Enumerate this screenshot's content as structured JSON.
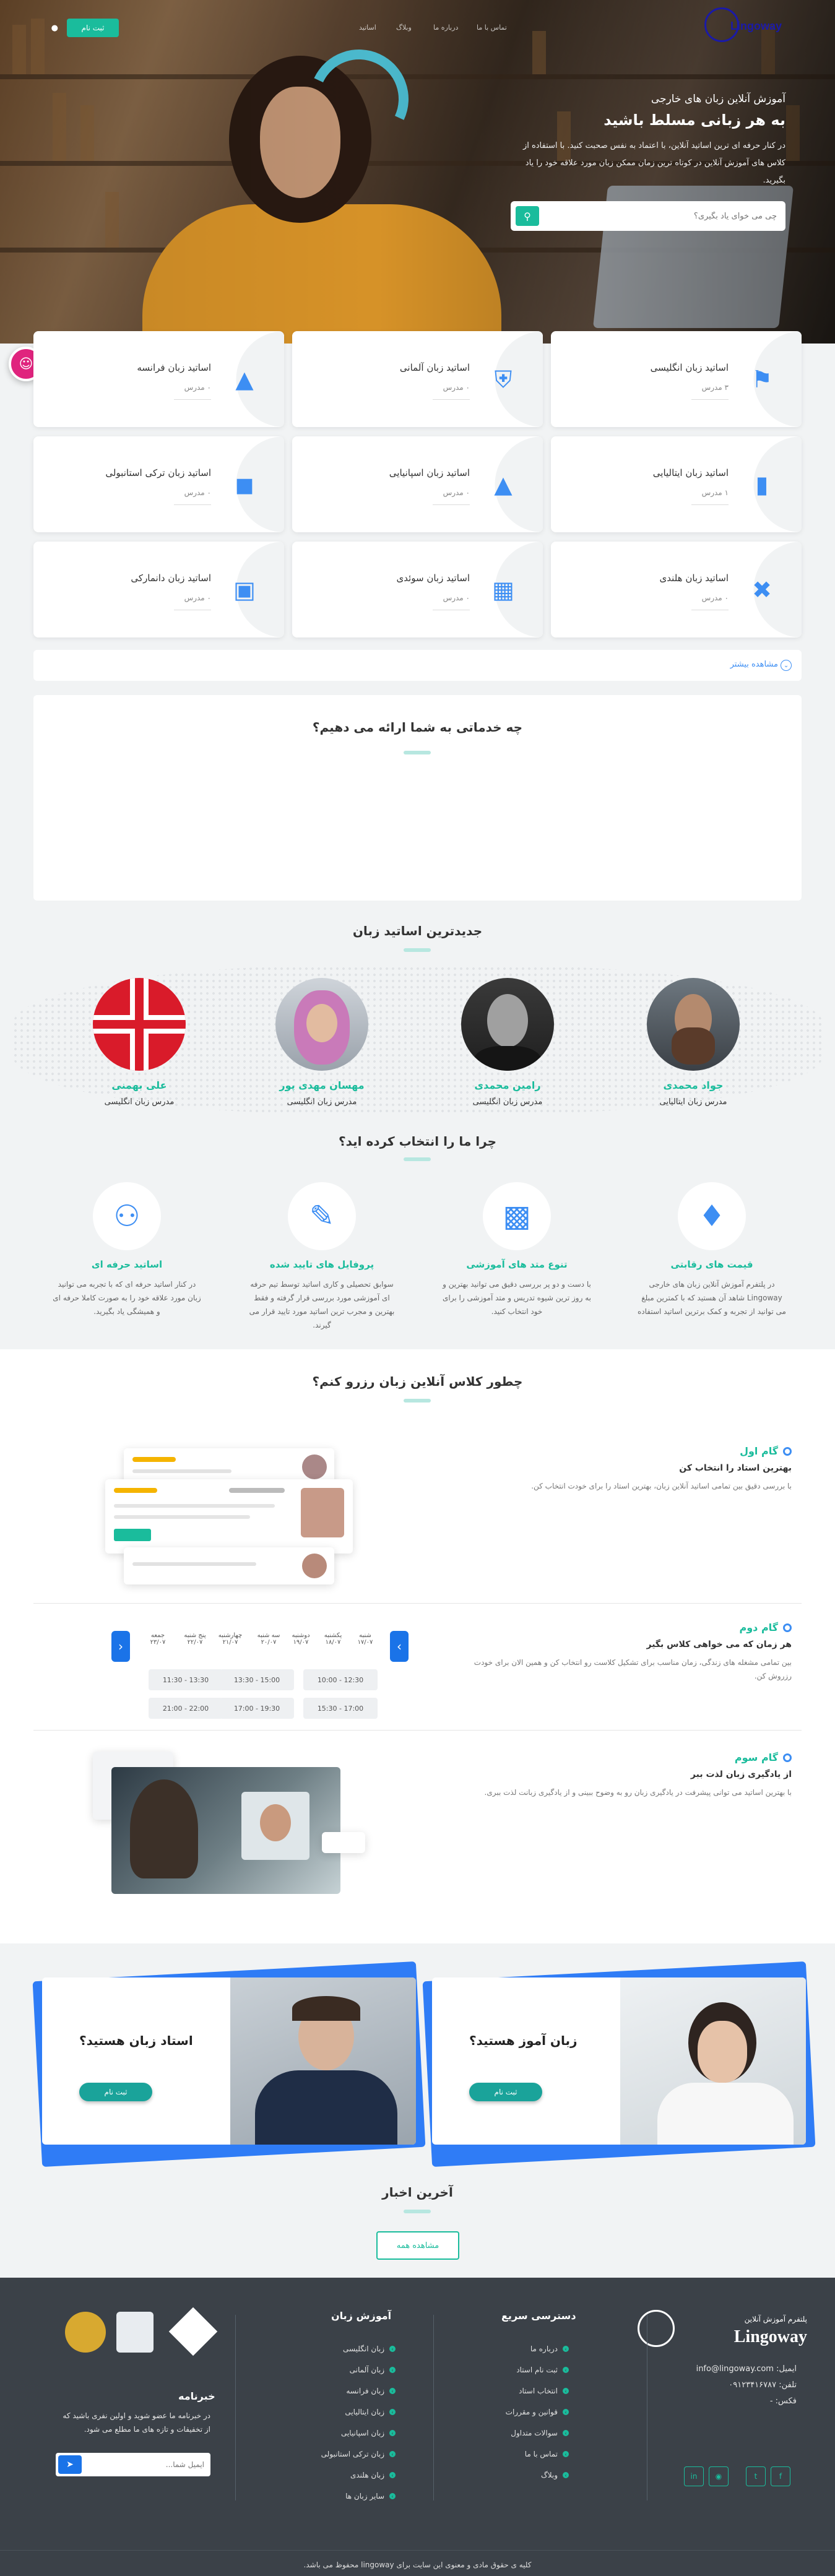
{
  "header": {
    "brand": "Lingoway",
    "register_label": "ثبت نام",
    "nav": [
      "اساتید",
      "وبلاگ",
      "درباره ما",
      "تماس با ما"
    ]
  },
  "hero": {
    "kicker": "آموزش آنلاین زبان های خارجی",
    "headline": "به هر زبانی مسلط باشید",
    "description": "در کنار حرفه ای ترین اساتید آنلاین، با اعتماد به نفس صحبت کنید. با استفاده از کلاس های آموزش آنلاین در کوتاه ترین زمان ممکن زبان مورد علاقه خود را یاد بگیرید.",
    "search_placeholder": "چی می خوای یاد بگیری؟"
  },
  "teacher_cards": [
    {
      "title": "اساتید زبان انگلیسی",
      "count": "۳ مدرس",
      "icon": "big-ben-icon"
    },
    {
      "title": "اساتید زبان آلمانی",
      "count": "۰ مدرس",
      "icon": "brandenburg-gate-icon"
    },
    {
      "title": "اساتید زبان فرانسه",
      "count": "۰ مدرس",
      "icon": "eiffel-tower-icon"
    },
    {
      "title": "اساتید زبان ایتالیایی",
      "count": "۱ مدرس",
      "icon": "pisa-tower-icon"
    },
    {
      "title": "اساتید زبان اسپانیایی",
      "count": "۰ مدرس",
      "icon": "sagrada-familia-icon"
    },
    {
      "title": "اساتید زبان ترکی استانبولی",
      "count": "۰ مدرس",
      "icon": "mosque-icon"
    },
    {
      "title": "اساتید زبان هلندی",
      "count": "۰ مدرس",
      "icon": "windmill-icon"
    },
    {
      "title": "اساتید زبان سوئدی",
      "count": "۰ مدرس",
      "icon": "swedish-building-icon"
    },
    {
      "title": "اساتید زبان دانمارکی",
      "count": "۰ مدرس",
      "icon": "danish-palace-icon"
    }
  ],
  "more_label": "مشاهده بیشتر",
  "services_title": "چه خدماتی به شما ارائه می دهیم؟",
  "new_teachers": {
    "title": "جدیدترین اساتید زبان",
    "items": [
      {
        "name": "جواد محمدی",
        "role": "مدرس زبان ایتالیایی"
      },
      {
        "name": "رامین محمدی",
        "role": "مدرس زبان انگلیسی"
      },
      {
        "name": "مهسان مهدی پور",
        "role": "مدرس زبان انگلیسی"
      },
      {
        "name": "علی بهمنی",
        "role": "مدرس زبان انگلیسی"
      }
    ]
  },
  "why_us": {
    "title": "چرا ما را انتخاب کرده اید؟",
    "items": [
      {
        "title": "قیمت های رقابتی",
        "desc": "در پلتفرم آموزش آنلاین زبان های خارجی Lingoway شاهد آن هستید که با کمترین مبلغ می توانید از تجربه و کمک برترین اساتید استفاده",
        "icon": "price-tag-icon"
      },
      {
        "title": "تنوع متد های آموزشی",
        "desc": "با دست و دو پر بررسی دقیق می توانید بهترین و به روز ترین شیوه تدریس و متد آموزشی را برای خود انتخاب کنید.",
        "icon": "teaching-board-icon"
      },
      {
        "title": "پروفایل های تایید شده",
        "desc": "سوابق تحصیلی و کاری اساتید توسط تیم حرفه ای آموزشی مورد بررسی قرار گرفته و فقط بهترین و مجرب ترین اساتید مورد تایید قرار می گیرند.",
        "icon": "verified-profile-icon"
      },
      {
        "title": "اساتید حرفه ای",
        "desc": "در کنار اساتید حرفه ای که با تجربه می توانید زبان مورد علاقه خود را به صورت کاملا حرفه ای و همیشگی یاد بگیرید.",
        "icon": "professional-teacher-icon"
      }
    ]
  },
  "booking": {
    "title": "چطور کلاس آنلاین زبان رزرو کنم؟",
    "steps": [
      {
        "label": "گام اول",
        "subtitle": "بهترین استاد را انتخاب کن",
        "desc": "با بررسی دقیق بین تمامی اساتید آنلاین زبان، بهترین استاد را برای خودت انتخاب کن."
      },
      {
        "label": "گام دوم",
        "subtitle": "هر زمان که می خواهی کلاس بگیر",
        "desc": "بین تمامی مشغله های زندگی، زمان مناسب برای تشکیل کلاست رو انتخاب کن و همین الان برای خودت رزروش کن."
      },
      {
        "label": "گام سوم",
        "subtitle": "از یادگیری زبان لذت ببر",
        "desc": "با بهترین اساتید می توانی پیشرفت در یادگیری زبان رو به وضوح ببینی و از یادگیری زبانت لذت ببری."
      }
    ],
    "schedule": {
      "days": [
        "شنبه",
        "یکشنبه",
        "دوشنبه",
        "سه شنبه",
        "چهارشنبه",
        "پنج شنبه",
        "جمعه"
      ],
      "dates": [
        "۱۷/۰۷",
        "۱۸/۰۷",
        "۱۹/۰۷",
        "۲۰/۰۷",
        "۲۱/۰۷",
        "۲۲/۰۷",
        "۲۳/۰۷"
      ],
      "slots": [
        "10:00 - 12:30",
        "13:30 - 15:00",
        "11:30 - 13:30",
        "15:30 - 17:00",
        "17:00 - 19:30",
        "21:00 - 22:00"
      ]
    }
  },
  "cta": [
    {
      "title": "زبان آموز هستید؟",
      "button": "ثبت نام"
    },
    {
      "title": "استاد زبان هستید؟",
      "button": "ثبت نام"
    }
  ],
  "news": {
    "title": "آخرین اخبار",
    "button": "مشاهده همه"
  },
  "footer": {
    "brand_tag": "پلتفرم آموزش آنلاین",
    "brand": "Lingoway",
    "email": "ایمیل: info@lingoway.com",
    "phone": "تلفن: ۰۹۱۲۳۴۱۶۷۸۷",
    "fax": "فکس: -",
    "quick_access_title": "دسترسی سریع",
    "quick_access": [
      "درباره ما",
      "ثبت نام استاد",
      "انتخاب استاد",
      "قوانین و مقررات",
      "سوالات متداول",
      "تماس با ما",
      "وبلاگ"
    ],
    "learn_title": "آموزش زبان",
    "learn": [
      "زبان انگلیسی",
      "زبان آلمانی",
      "زبان فرانسه",
      "زبان ایتالیایی",
      "زبان اسپانیایی",
      "زبان ترکی استانبولی",
      "زبان هلندی",
      "سایر زبان ها"
    ],
    "newsletter_title": "خبرنامه",
    "newsletter_desc": "در خبرنامه ما عضو شوید و اولین نفری باشید که از تخفیفات و تازه های ما مطلع می شود.",
    "newsletter_placeholder": "ایمیل شما...",
    "copyright": "کلیه ی حقوق مادی و معنوی این سایت برای lingoway محفوظ می باشد."
  },
  "colors": {
    "accent": "#1abc9c",
    "blue": "#3d8ef3",
    "footer": "#3b4148"
  }
}
